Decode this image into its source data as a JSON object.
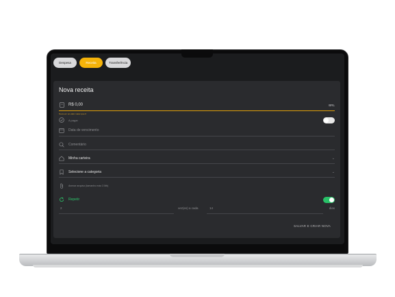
{
  "tabs": [
    {
      "label": "Despesa",
      "active": false
    },
    {
      "label": "Receita",
      "active": true
    },
    {
      "label": "Transferência",
      "active": false
    }
  ],
  "form": {
    "title": "Nova receita",
    "amount_value": "R$ 0,00",
    "currency": "BRL",
    "amount_hint": "Nova em só valor maior que 0",
    "paid_label": "A pagar",
    "due_date_placeholder": "Data de vencimento",
    "comment_placeholder": "Comentário",
    "wallet_value": "Minha carteira",
    "category_value": "Selecione a categoria",
    "attachment_label": "Anexar arquivo (tamanho máx 3 Mb)",
    "repeat_label": "Repetir",
    "repeat_count": "2",
    "repeat_unit_label": "vez(es) a cada",
    "repeat_interval": "14",
    "repeat_interval_unit": "dias",
    "save_label": "SALVAR E CRIAR NOVA"
  },
  "colors": {
    "accent": "#f5b30a",
    "toggle_on": "#29c168",
    "panel_bg": "#2a2b2e"
  },
  "icons": [
    "wallet-icon",
    "check-circle-icon",
    "calendar-icon",
    "search-icon",
    "home-icon",
    "bookmark-icon",
    "paperclip-icon",
    "repeat-icon",
    "chevron-down-icon"
  ]
}
